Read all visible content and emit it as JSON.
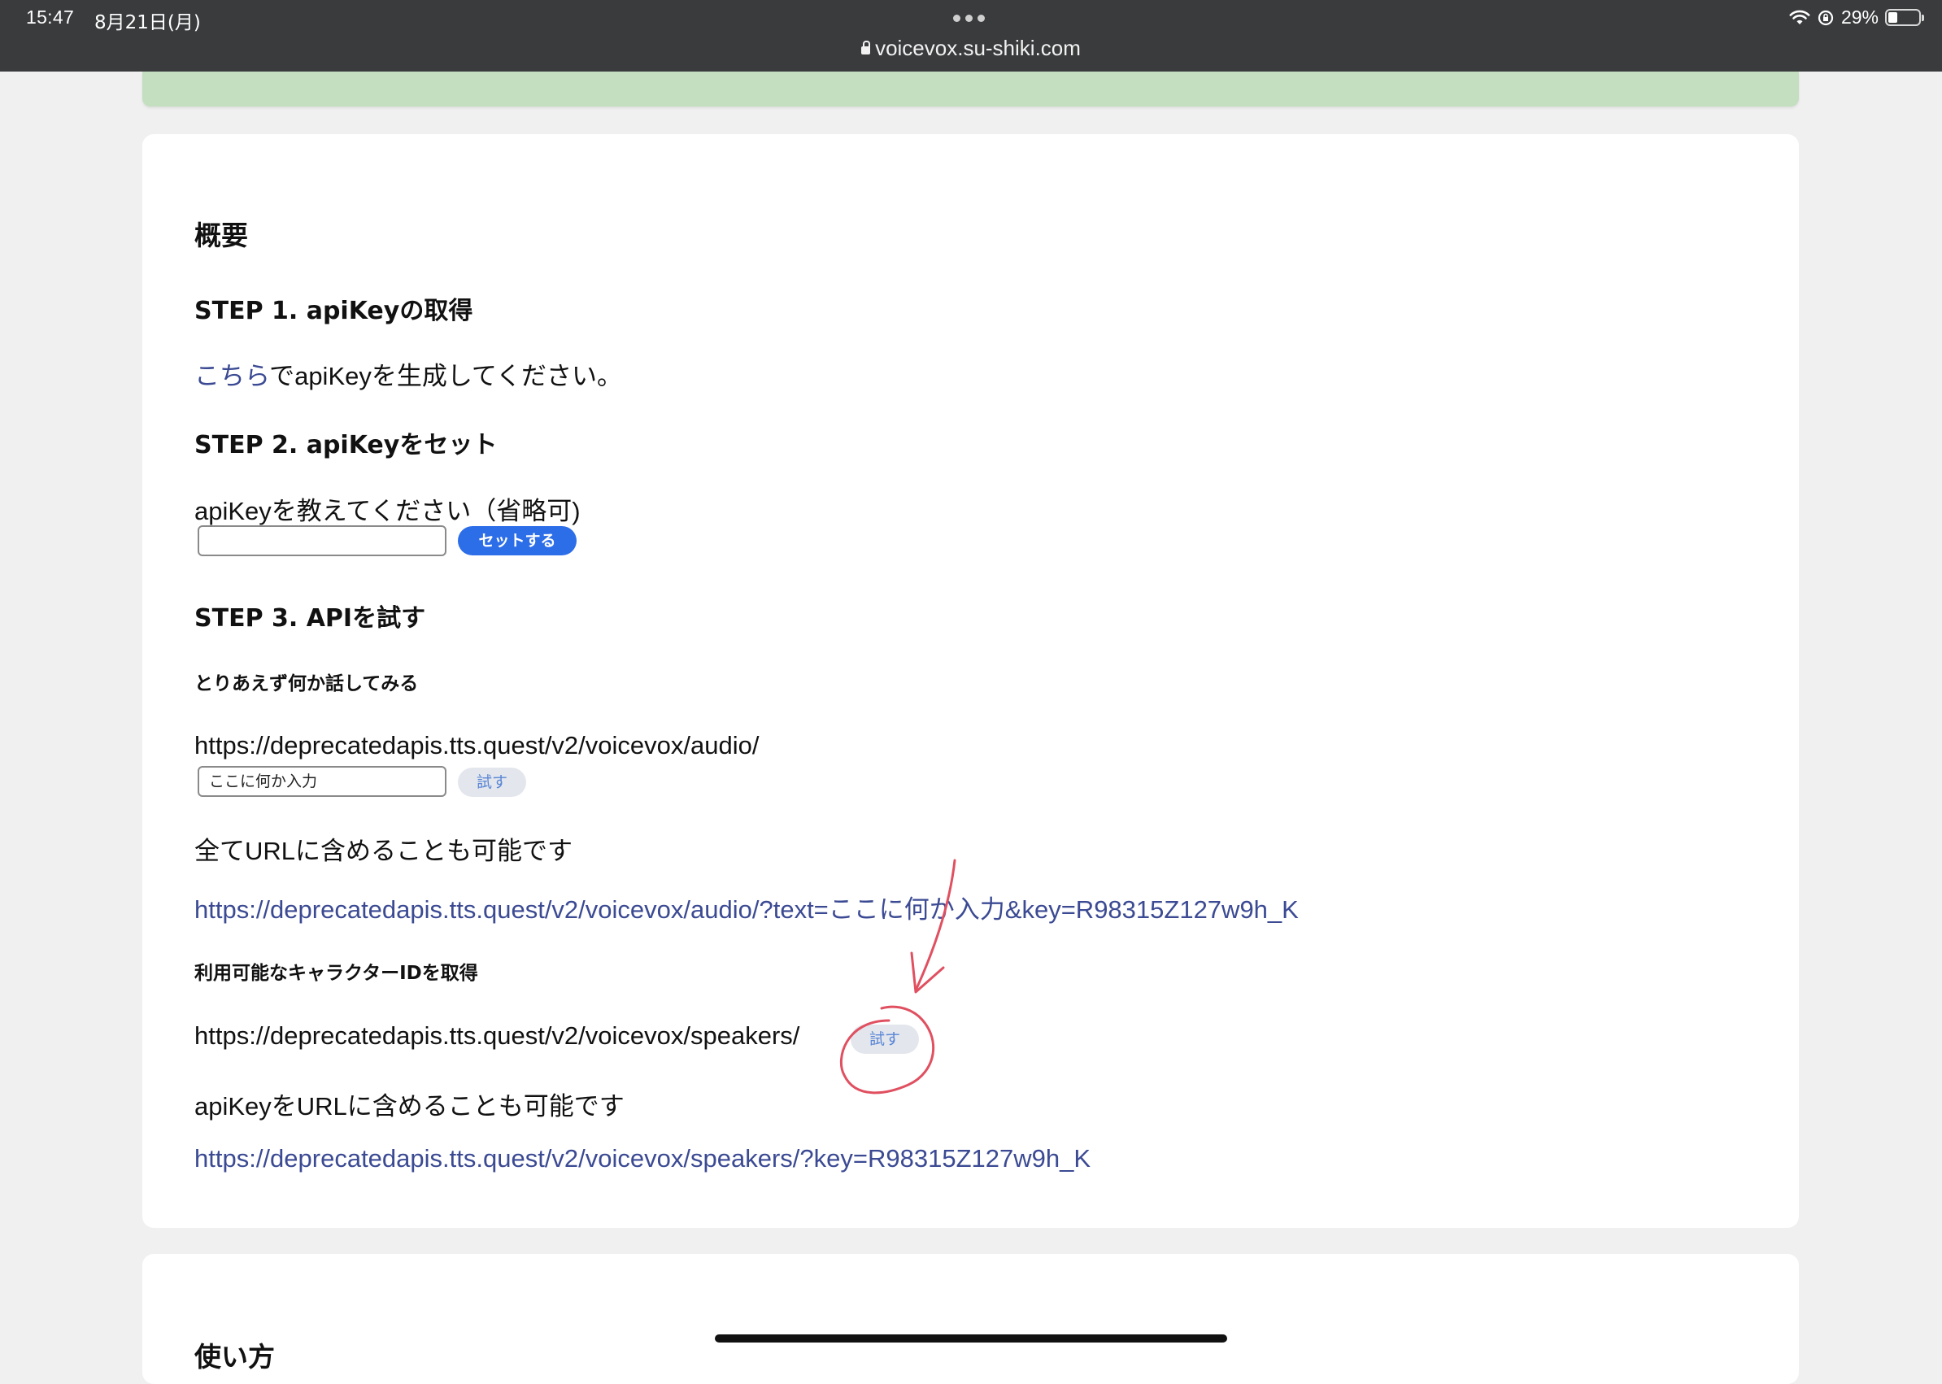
{
  "status_bar": {
    "time": "15:47",
    "date": "8月21日(月)",
    "url": "voicevox.su-shiki.com",
    "battery": "29%",
    "wifi_icon": "wifi-icon",
    "rotation_lock_icon": "rotation-lock-icon",
    "battery_level": 0.29
  },
  "overview": {
    "title": "概要",
    "step1": {
      "heading": "STEP 1. apiKeyの取得",
      "link_text": "こちら",
      "text": "でapiKeyを生成してください。"
    },
    "step2": {
      "heading": "STEP 2. apiKeyをセット",
      "prompt": "apiKeyを教えてください（省略可)",
      "input_value": "",
      "set_button": "セットする"
    },
    "step3": {
      "heading": "STEP 3. APIを試す",
      "talk": {
        "heading": "とりあえず何か話してみる",
        "endpoint": "https://deprecatedapis.tts.quest/v2/voicevox/audio/",
        "input_placeholder": "ここに何か入力",
        "try_button": "試す",
        "note": "全てURLに含めることも可能です",
        "example_url": "https://deprecatedapis.tts.quest/v2/voicevox/audio/?text=ここに何か入力&key=R98315Z127w9h_K"
      },
      "speakers": {
        "heading": "利用可能なキャラクターIDを取得",
        "endpoint": "https://deprecatedapis.tts.quest/v2/voicevox/speakers/",
        "try_button": "試す",
        "note": "apiKeyをURLに含めることも可能です",
        "example_url": "https://deprecatedapis.tts.quest/v2/voicevox/speakers/?key=R98315Z127w9h_K"
      }
    }
  },
  "next_section": {
    "title": "使い方"
  },
  "annotation": {
    "color": "#e05060"
  }
}
